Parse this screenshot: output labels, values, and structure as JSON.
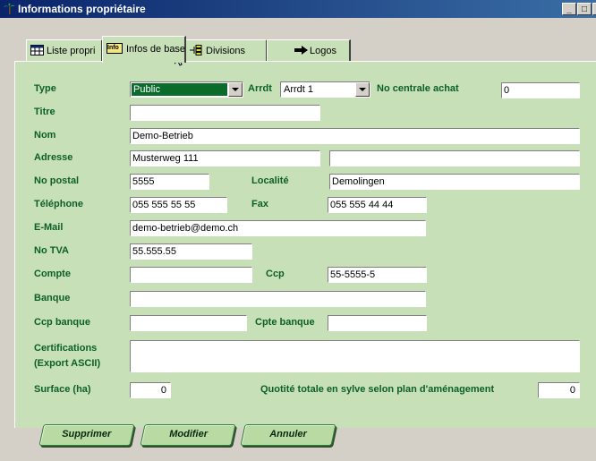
{
  "window": {
    "title": "Informations propriétaire",
    "minimize_label": "_",
    "maximize_label": "□",
    "close_label": "x"
  },
  "tabs": [
    {
      "label": "Liste propri",
      "icon": "table-icon"
    },
    {
      "label": "Infos de base",
      "icon": "info-icon",
      "badge": "Info"
    },
    {
      "label": "Divisions",
      "icon": "tree-icon"
    },
    {
      "label": "Logos",
      "icon": "arrow-right-icon"
    }
  ],
  "active_tab": "Infos de base",
  "form": {
    "type_label": "Type",
    "type_value": "Public",
    "arrdt_label": "Arrdt",
    "arrdt_value": "Arrdt 1",
    "centrale_label": "No centrale achat",
    "centrale_value": "0",
    "titre_label": "Titre",
    "titre_value": "",
    "nom_label": "Nom",
    "nom_value": "Demo-Betrieb",
    "adresse_label": "Adresse",
    "adresse_value": "Musterweg 111",
    "adresse2_value": "",
    "postal_label": "No postal",
    "postal_value": "5555",
    "localite_label": "Localité",
    "localite_value": "Demolingen",
    "tel_label": "Téléphone",
    "tel_value": "055 555 55 55",
    "fax_label": "Fax",
    "fax_value": "055 555 44 44",
    "email_label": "E-Mail",
    "email_value": "demo-betrieb@demo.ch",
    "tva_label": "No TVA",
    "tva_value": "55.555.55",
    "compte_label": "Compte",
    "compte_value": "",
    "ccp_label": "Ccp",
    "ccp_value": "55-5555-5",
    "banque_label": "Banque",
    "banque_value": "",
    "ccpbanque_label": "Ccp banque",
    "ccpbanque_value": "",
    "cptebanque_label": "Cpte banque",
    "cptebanque_value": "",
    "cert_label_1": "Certifications",
    "cert_label_2": "(Export ASCII)",
    "cert_value": "",
    "surface_label": "Surface (ha)",
    "surface_value": "0",
    "quotite_label": "Quotité totale en sylve selon plan d'aménagement",
    "quotite_value": "0"
  },
  "buttons": {
    "supprimer": "Supprimer",
    "modifier": "Modifier",
    "annuler": "Annuler"
  },
  "colors": {
    "panel": "#c8e0b8",
    "label": "#0b5f28",
    "titlebar": "#0a246a"
  }
}
